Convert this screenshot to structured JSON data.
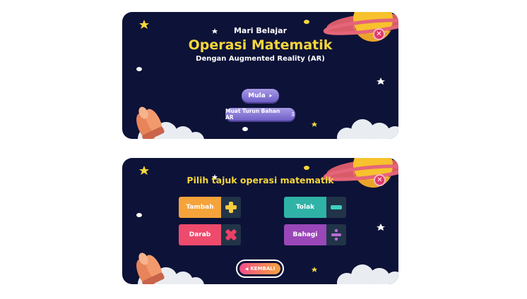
{
  "screen1": {
    "pre_title": "Mari Belajar",
    "title": "Operasi Matematik",
    "subtitle": "Dengan Augmented Reality (AR)",
    "start_button": {
      "label": "Mula",
      "icon": "play-icon"
    },
    "download_button": {
      "label": "Muat Turun Bahan AR",
      "icon": "download-icon"
    },
    "close_icon": "close-icon"
  },
  "screen2": {
    "heading": "Pilih tajuk operasi matematik",
    "close_icon": "close-icon",
    "operations": [
      {
        "label": "Tambah",
        "symbol": "plus-icon",
        "color": "#f5a33a"
      },
      {
        "label": "Tolak",
        "symbol": "minus-icon",
        "color": "#2fb3a6"
      },
      {
        "label": "Darab",
        "symbol": "multiply-icon",
        "color": "#ee4a6c"
      },
      {
        "label": "Bahagi",
        "symbol": "divide-icon",
        "color": "#9a47b8"
      }
    ],
    "back_button": {
      "label": "KEMBALI",
      "icon": "back-arrow-icon"
    }
  },
  "colors": {
    "background": "#0d1238",
    "title_yellow": "#f5d63c",
    "plus_yellow": "#f5cc3c",
    "multiply_pink": "#ee3f66",
    "minus_teal": "#3dd0c1",
    "divide_purple": "#b86ad6"
  }
}
